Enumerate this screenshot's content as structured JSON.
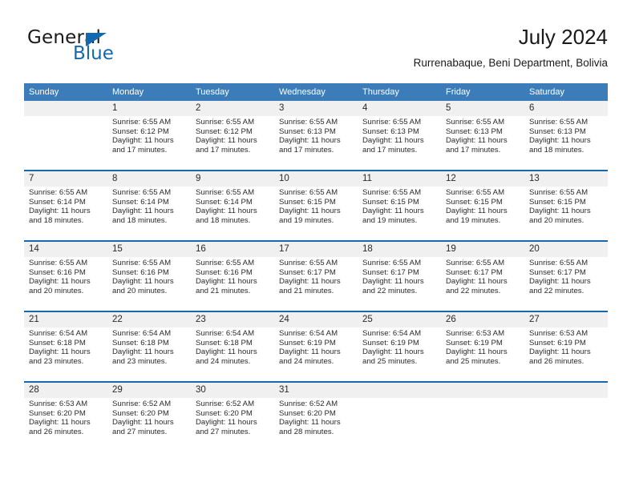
{
  "brand": {
    "name_part1": "General",
    "name_part2": "Blue",
    "triangle_color": "#1269b0"
  },
  "header": {
    "title": "July 2024",
    "location": "Rurrenabaque, Beni Department, Bolivia"
  },
  "colors": {
    "header_row_bg": "#3b7cb9",
    "week_separator": "#1269b0",
    "daynum_bg": "#f0f0f0",
    "brand_blue": "#1269b0"
  },
  "weekday_headers": [
    "Sunday",
    "Monday",
    "Tuesday",
    "Wednesday",
    "Thursday",
    "Friday",
    "Saturday"
  ],
  "weeks": [
    [
      {
        "day": "",
        "blank": true,
        "sunrise": "",
        "sunset": "",
        "daylight_line1": "",
        "daylight_line2": ""
      },
      {
        "day": "1",
        "blank": false,
        "sunrise": "Sunrise: 6:55 AM",
        "sunset": "Sunset: 6:12 PM",
        "daylight_line1": "Daylight: 11 hours",
        "daylight_line2": "and 17 minutes."
      },
      {
        "day": "2",
        "blank": false,
        "sunrise": "Sunrise: 6:55 AM",
        "sunset": "Sunset: 6:12 PM",
        "daylight_line1": "Daylight: 11 hours",
        "daylight_line2": "and 17 minutes."
      },
      {
        "day": "3",
        "blank": false,
        "sunrise": "Sunrise: 6:55 AM",
        "sunset": "Sunset: 6:13 PM",
        "daylight_line1": "Daylight: 11 hours",
        "daylight_line2": "and 17 minutes."
      },
      {
        "day": "4",
        "blank": false,
        "sunrise": "Sunrise: 6:55 AM",
        "sunset": "Sunset: 6:13 PM",
        "daylight_line1": "Daylight: 11 hours",
        "daylight_line2": "and 17 minutes."
      },
      {
        "day": "5",
        "blank": false,
        "sunrise": "Sunrise: 6:55 AM",
        "sunset": "Sunset: 6:13 PM",
        "daylight_line1": "Daylight: 11 hours",
        "daylight_line2": "and 17 minutes."
      },
      {
        "day": "6",
        "blank": false,
        "sunrise": "Sunrise: 6:55 AM",
        "sunset": "Sunset: 6:13 PM",
        "daylight_line1": "Daylight: 11 hours",
        "daylight_line2": "and 18 minutes."
      }
    ],
    [
      {
        "day": "7",
        "blank": false,
        "sunrise": "Sunrise: 6:55 AM",
        "sunset": "Sunset: 6:14 PM",
        "daylight_line1": "Daylight: 11 hours",
        "daylight_line2": "and 18 minutes."
      },
      {
        "day": "8",
        "blank": false,
        "sunrise": "Sunrise: 6:55 AM",
        "sunset": "Sunset: 6:14 PM",
        "daylight_line1": "Daylight: 11 hours",
        "daylight_line2": "and 18 minutes."
      },
      {
        "day": "9",
        "blank": false,
        "sunrise": "Sunrise: 6:55 AM",
        "sunset": "Sunset: 6:14 PM",
        "daylight_line1": "Daylight: 11 hours",
        "daylight_line2": "and 18 minutes."
      },
      {
        "day": "10",
        "blank": false,
        "sunrise": "Sunrise: 6:55 AM",
        "sunset": "Sunset: 6:15 PM",
        "daylight_line1": "Daylight: 11 hours",
        "daylight_line2": "and 19 minutes."
      },
      {
        "day": "11",
        "blank": false,
        "sunrise": "Sunrise: 6:55 AM",
        "sunset": "Sunset: 6:15 PM",
        "daylight_line1": "Daylight: 11 hours",
        "daylight_line2": "and 19 minutes."
      },
      {
        "day": "12",
        "blank": false,
        "sunrise": "Sunrise: 6:55 AM",
        "sunset": "Sunset: 6:15 PM",
        "daylight_line1": "Daylight: 11 hours",
        "daylight_line2": "and 19 minutes."
      },
      {
        "day": "13",
        "blank": false,
        "sunrise": "Sunrise: 6:55 AM",
        "sunset": "Sunset: 6:15 PM",
        "daylight_line1": "Daylight: 11 hours",
        "daylight_line2": "and 20 minutes."
      }
    ],
    [
      {
        "day": "14",
        "blank": false,
        "sunrise": "Sunrise: 6:55 AM",
        "sunset": "Sunset: 6:16 PM",
        "daylight_line1": "Daylight: 11 hours",
        "daylight_line2": "and 20 minutes."
      },
      {
        "day": "15",
        "blank": false,
        "sunrise": "Sunrise: 6:55 AM",
        "sunset": "Sunset: 6:16 PM",
        "daylight_line1": "Daylight: 11 hours",
        "daylight_line2": "and 20 minutes."
      },
      {
        "day": "16",
        "blank": false,
        "sunrise": "Sunrise: 6:55 AM",
        "sunset": "Sunset: 6:16 PM",
        "daylight_line1": "Daylight: 11 hours",
        "daylight_line2": "and 21 minutes."
      },
      {
        "day": "17",
        "blank": false,
        "sunrise": "Sunrise: 6:55 AM",
        "sunset": "Sunset: 6:17 PM",
        "daylight_line1": "Daylight: 11 hours",
        "daylight_line2": "and 21 minutes."
      },
      {
        "day": "18",
        "blank": false,
        "sunrise": "Sunrise: 6:55 AM",
        "sunset": "Sunset: 6:17 PM",
        "daylight_line1": "Daylight: 11 hours",
        "daylight_line2": "and 22 minutes."
      },
      {
        "day": "19",
        "blank": false,
        "sunrise": "Sunrise: 6:55 AM",
        "sunset": "Sunset: 6:17 PM",
        "daylight_line1": "Daylight: 11 hours",
        "daylight_line2": "and 22 minutes."
      },
      {
        "day": "20",
        "blank": false,
        "sunrise": "Sunrise: 6:55 AM",
        "sunset": "Sunset: 6:17 PM",
        "daylight_line1": "Daylight: 11 hours",
        "daylight_line2": "and 22 minutes."
      }
    ],
    [
      {
        "day": "21",
        "blank": false,
        "sunrise": "Sunrise: 6:54 AM",
        "sunset": "Sunset: 6:18 PM",
        "daylight_line1": "Daylight: 11 hours",
        "daylight_line2": "and 23 minutes."
      },
      {
        "day": "22",
        "blank": false,
        "sunrise": "Sunrise: 6:54 AM",
        "sunset": "Sunset: 6:18 PM",
        "daylight_line1": "Daylight: 11 hours",
        "daylight_line2": "and 23 minutes."
      },
      {
        "day": "23",
        "blank": false,
        "sunrise": "Sunrise: 6:54 AM",
        "sunset": "Sunset: 6:18 PM",
        "daylight_line1": "Daylight: 11 hours",
        "daylight_line2": "and 24 minutes."
      },
      {
        "day": "24",
        "blank": false,
        "sunrise": "Sunrise: 6:54 AM",
        "sunset": "Sunset: 6:19 PM",
        "daylight_line1": "Daylight: 11 hours",
        "daylight_line2": "and 24 minutes."
      },
      {
        "day": "25",
        "blank": false,
        "sunrise": "Sunrise: 6:54 AM",
        "sunset": "Sunset: 6:19 PM",
        "daylight_line1": "Daylight: 11 hours",
        "daylight_line2": "and 25 minutes."
      },
      {
        "day": "26",
        "blank": false,
        "sunrise": "Sunrise: 6:53 AM",
        "sunset": "Sunset: 6:19 PM",
        "daylight_line1": "Daylight: 11 hours",
        "daylight_line2": "and 25 minutes."
      },
      {
        "day": "27",
        "blank": false,
        "sunrise": "Sunrise: 6:53 AM",
        "sunset": "Sunset: 6:19 PM",
        "daylight_line1": "Daylight: 11 hours",
        "daylight_line2": "and 26 minutes."
      }
    ],
    [
      {
        "day": "28",
        "blank": false,
        "sunrise": "Sunrise: 6:53 AM",
        "sunset": "Sunset: 6:20 PM",
        "daylight_line1": "Daylight: 11 hours",
        "daylight_line2": "and 26 minutes."
      },
      {
        "day": "29",
        "blank": false,
        "sunrise": "Sunrise: 6:52 AM",
        "sunset": "Sunset: 6:20 PM",
        "daylight_line1": "Daylight: 11 hours",
        "daylight_line2": "and 27 minutes."
      },
      {
        "day": "30",
        "blank": false,
        "sunrise": "Sunrise: 6:52 AM",
        "sunset": "Sunset: 6:20 PM",
        "daylight_line1": "Daylight: 11 hours",
        "daylight_line2": "and 27 minutes."
      },
      {
        "day": "31",
        "blank": false,
        "sunrise": "Sunrise: 6:52 AM",
        "sunset": "Sunset: 6:20 PM",
        "daylight_line1": "Daylight: 11 hours",
        "daylight_line2": "and 28 minutes."
      },
      {
        "day": "",
        "blank": true,
        "sunrise": "",
        "sunset": "",
        "daylight_line1": "",
        "daylight_line2": ""
      },
      {
        "day": "",
        "blank": true,
        "sunrise": "",
        "sunset": "",
        "daylight_line1": "",
        "daylight_line2": ""
      },
      {
        "day": "",
        "blank": true,
        "sunrise": "",
        "sunset": "",
        "daylight_line1": "",
        "daylight_line2": ""
      }
    ]
  ]
}
